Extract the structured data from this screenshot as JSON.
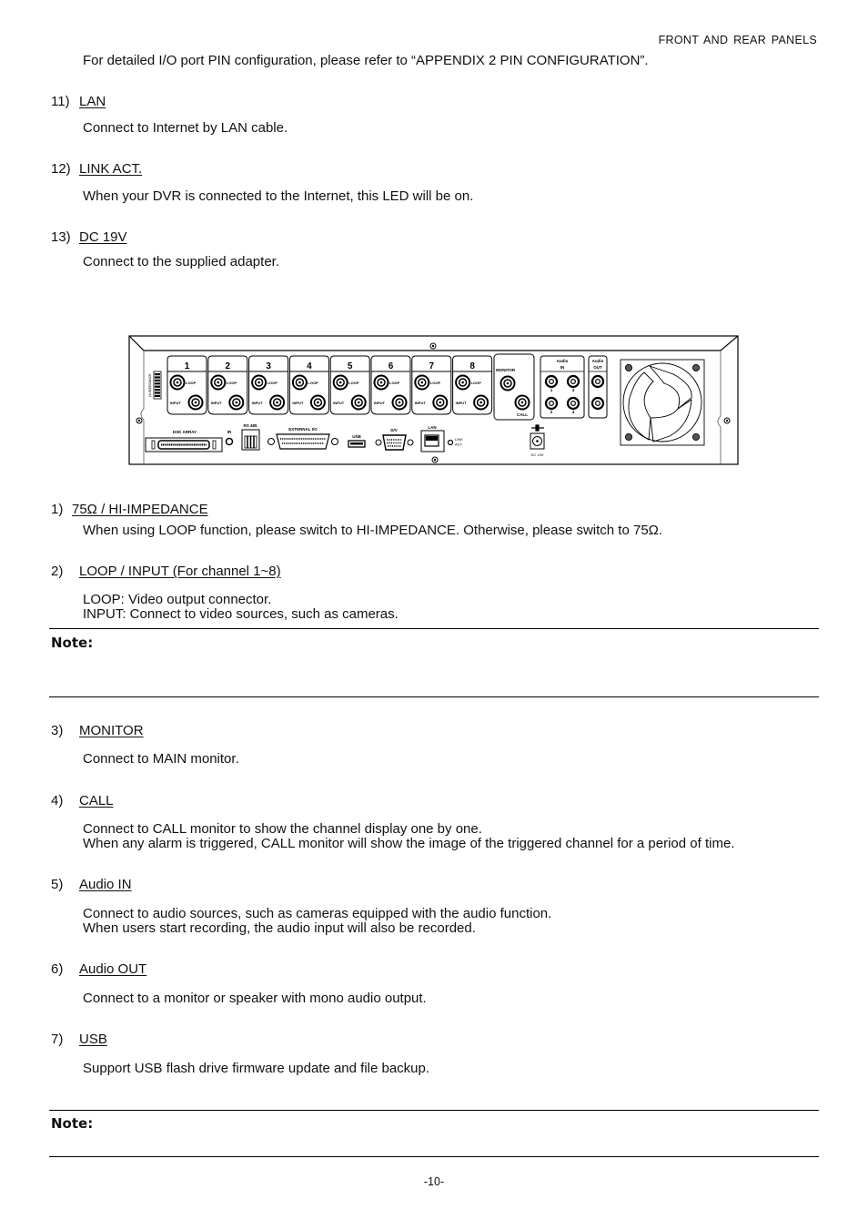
{
  "header": {
    "section_title": "FRONT AND REAR PANELS"
  },
  "intro": {
    "text": "For detailed I/O port PIN configuration, please refer to “APPENDIX 2 PIN CONFIGURATION”."
  },
  "front_items": [
    {
      "number": "11)",
      "title": "LAN",
      "lines": [
        "Connect to Internet by LAN cable."
      ]
    },
    {
      "number": "12)",
      "title": "LINK ACT.",
      "lines": [
        "When your DVR is connected to the Internet, this LED will be on."
      ]
    },
    {
      "number": "13)",
      "title": "DC 19V",
      "lines": [
        "Connect to the supplied adapter."
      ]
    }
  ],
  "diagram": {
    "channels": [
      "1",
      "2",
      "3",
      "4",
      "5",
      "6",
      "7",
      "8"
    ],
    "loop_label": "LOOP",
    "input_label": "INPUT",
    "monitor_label": "MONITOR",
    "call_label": "CALL",
    "audio_in_label": "Audio IN",
    "audio_in_numbers": [
      "1",
      "3",
      "2",
      "4"
    ],
    "audio_out_label": "Audio OUT",
    "disk_array_label": "DSK ARRAY",
    "ir_label": "IR",
    "rs485_label": "RS 485",
    "external_io_label": "EXTERNAL I/O",
    "usb_label": "USB",
    "dv_label": "D/V",
    "lan_label": "LAN",
    "link_act_label": [
      "LINK",
      "ACT."
    ],
    "dc_label": "DC 19V",
    "impedance_label": "HI-IMPEDANCE"
  },
  "rear_items": [
    {
      "number": "1)",
      "title": "75Ω / HI-IMPEDANCE",
      "lines": [
        "When using LOOP function, please switch to HI-IMPEDANCE. Otherwise, please switch to 75Ω."
      ]
    },
    {
      "number": "2)",
      "title": "LOOP / INPUT (For channel 1~8)",
      "lines": [
        "LOOP: Video output connector.",
        "INPUT: Connect to video sources, such as cameras."
      ]
    },
    {
      "number": "3)",
      "title": "MONITOR",
      "lines": [
        "Connect to MAIN monitor."
      ]
    },
    {
      "number": "4)",
      "title": "CALL",
      "lines": [
        "Connect to CALL monitor to show the channel display one by one.",
        "When any alarm is triggered, CALL monitor will show the image of the triggered channel for a period of time."
      ]
    },
    {
      "number": "5)",
      "title": "Audio IN",
      "lines": [
        "Connect to audio sources, such as cameras equipped with the audio function.",
        "When users start recording, the audio input will also be recorded."
      ]
    },
    {
      "number": "6)",
      "title": "Audio OUT",
      "lines": [
        "Connect to a monitor or speaker with mono audio output."
      ]
    },
    {
      "number": "7)",
      "title": "USB",
      "lines": [
        "Support USB flash drive firmware update and file backup."
      ]
    }
  ],
  "notes": [
    {
      "label": "Note:"
    },
    {
      "label": "Note:"
    }
  ],
  "footer": {
    "page_number": "-10-"
  }
}
